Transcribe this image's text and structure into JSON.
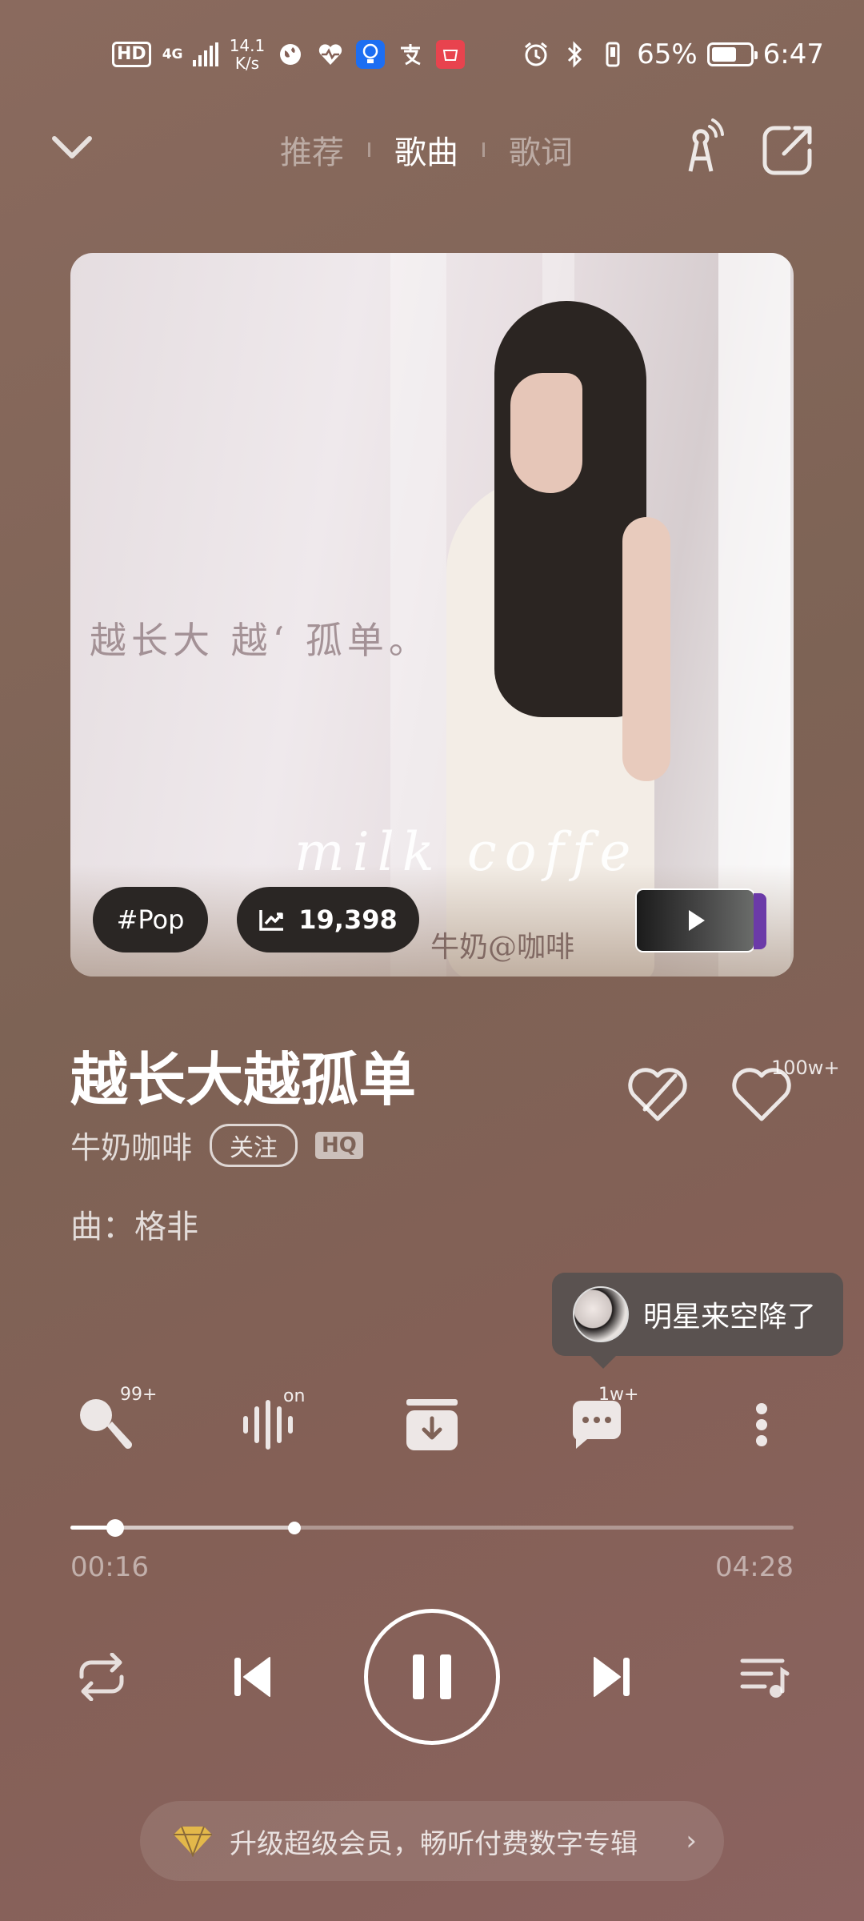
{
  "status_bar": {
    "hd": "HD",
    "network": "4G",
    "speed_value": "14.1",
    "speed_unit": "K/s",
    "battery_percent": "65%",
    "battery_level": 0.65,
    "time": "6:47",
    "icons": [
      "globe-icon",
      "heartbeat-icon",
      "lightbulb-app-icon",
      "alipay-icon",
      "huawei-app-icon",
      "alarm-icon",
      "bluetooth-icon",
      "vibrate-icon",
      "battery-icon"
    ]
  },
  "nav": {
    "tabs": [
      {
        "label": "推荐",
        "active": false
      },
      {
        "label": "歌曲",
        "active": true
      },
      {
        "label": "歌词",
        "active": false
      }
    ],
    "icons": [
      "chevron-down-icon",
      "broadcast-icon",
      "share-icon"
    ]
  },
  "album": {
    "cover_title_text": "越长大 越‘ 孤单。",
    "cover_brand_text": "milk  coffe",
    "cover_artist_text": "牛奶@咖啡",
    "genre_tag": "#Pop",
    "play_count": "19,398"
  },
  "song": {
    "title": "越长大越孤单",
    "artist": "牛奶咖啡",
    "follow_label": "关注",
    "quality_badge": "HQ",
    "composer": "曲：格非",
    "like_count": "100w+"
  },
  "tooltip": {
    "text": "明星来空降了"
  },
  "actions": {
    "mic_badge": "99+",
    "effect_badge": "on",
    "comment_badge": "1w+"
  },
  "progress": {
    "current": "00:16",
    "total": "04:28",
    "played_fraction": 0.062,
    "marker_fraction": 0.31
  },
  "vip": {
    "text": "升级超级会员，畅听付费数字专辑",
    "arrow": "›"
  },
  "colors": {
    "background": "#846056",
    "chip": "#2a2624",
    "tooltip": "#5a5250",
    "vip_gem": "#e3b84a"
  }
}
